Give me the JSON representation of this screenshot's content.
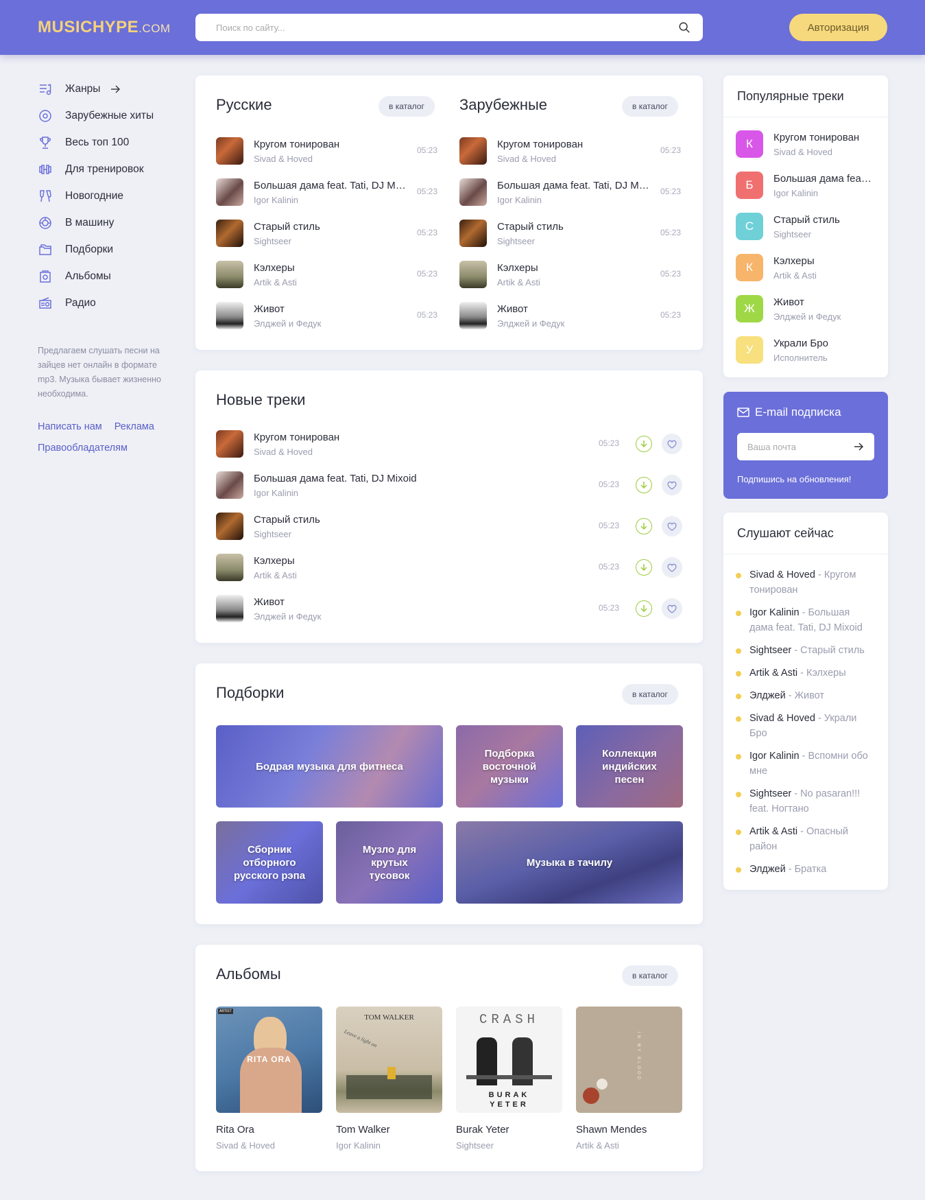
{
  "header": {
    "logo_main": "MUSICHYPE",
    "logo_domain": ".COM",
    "search_placeholder": "Поиск по сайту...",
    "auth_button": "Авторизация"
  },
  "sidebar": {
    "items": [
      {
        "label": "Жанры",
        "icon": "equalizer-icon"
      },
      {
        "label": "Зарубежные хиты",
        "icon": "disc-icon"
      },
      {
        "label": "Весь топ 100",
        "icon": "trophy-icon"
      },
      {
        "label": "Для тренировок",
        "icon": "dumbbell-icon"
      },
      {
        "label": "Новогодние",
        "icon": "glasses-icon"
      },
      {
        "label": "В машину",
        "icon": "wheel-icon"
      },
      {
        "label": "Подборки",
        "icon": "folders-icon"
      },
      {
        "label": "Альбомы",
        "icon": "album-icon"
      },
      {
        "label": "Радио",
        "icon": "radio-icon"
      }
    ],
    "about": "Предлагаем слушать песни на зайцев нет онлайн в формате mp3. Музыка бывает жизненно необходима.",
    "link_write": "Написать нам",
    "link_ads": "Реклама",
    "link_rights": "Правообладателям"
  },
  "tracks": [
    {
      "name": "Кругом тонирован",
      "artist": "Sivad & Hoved",
      "duration": "05:23"
    },
    {
      "name": "Большая дама feat. Tati, DJ Mixoid",
      "artist": "Igor Kalinin",
      "duration": "05:23"
    },
    {
      "name": "Старый стиль",
      "artist": "Sightseer",
      "duration": "05:23"
    },
    {
      "name": "Кэлхеры",
      "artist": "Artik & Asti",
      "duration": "05:23"
    },
    {
      "name": "Живот",
      "artist": "Элджей и Федук",
      "duration": "05:23"
    }
  ],
  "russian": {
    "title": "Русские",
    "catalog": "в каталог"
  },
  "foreign": {
    "title": "Зарубежные",
    "catalog": "в каталог"
  },
  "new_tracks": {
    "title": "Новые треки"
  },
  "collections": {
    "title": "Подборки",
    "catalog": "в каталог",
    "tiles": [
      "Бодрая музыка для фитнеса",
      "Подборка восточной музыки",
      "Коллекция индийских песен",
      "Сборник отборного русского рэпа",
      "Музло для крутых тусовок",
      "Музыка в тачилу"
    ]
  },
  "albums": {
    "title": "Альбомы",
    "catalog": "в каталог",
    "items": [
      {
        "name": "Rita Ora",
        "artist": "Sivad & Hoved",
        "cover_text": "RITA ORA",
        "badge": "ARTIST"
      },
      {
        "name": "Tom Walker",
        "artist": "Igor Kalinin",
        "cover_text": "TOM WALKER",
        "script": "Leave a light on"
      },
      {
        "name": "Burak Yeter",
        "artist": "Sightseer",
        "cover_text": "CRASH",
        "bottom_text": "BURAK YETER"
      },
      {
        "name": "Shawn Mendes",
        "artist": "Artik & Asti",
        "cover_text": "IN MY BLOOD"
      }
    ]
  },
  "popular": {
    "title": "Популярные треки",
    "items": [
      {
        "letter": "К",
        "name": "Кругом тонирован",
        "artist": "Sivad & Hoved",
        "color": "#d957e8"
      },
      {
        "letter": "Б",
        "name": "Большая дама feat. Tati",
        "artist": "Igor Kalinin",
        "color": "#f07070"
      },
      {
        "letter": "С",
        "name": "Старый стиль",
        "artist": "Sightseer",
        "color": "#6fd0d8"
      },
      {
        "letter": "К",
        "name": "Кэлхеры",
        "artist": "Artik & Asti",
        "color": "#f7b46b"
      },
      {
        "letter": "Ж",
        "name": "Живот",
        "artist": "Элджей и Федук",
        "color": "#9fd846"
      },
      {
        "letter": "У",
        "name": "Украли Бро",
        "artist": "Исполнитель",
        "color": "#f7e07d"
      }
    ]
  },
  "subscribe": {
    "title": "E-mail подписка",
    "placeholder": "Ваша почта",
    "note": "Подпишись на обновления!"
  },
  "listening": {
    "title": "Слушают сейчас",
    "items": [
      {
        "artist": "Sivad & Hoved",
        "track": "Кругом тонирован"
      },
      {
        "artist": "Igor Kalinin",
        "track": "Большая дама feat. Tati, DJ Mixoid"
      },
      {
        "artist": "Sightseer",
        "track": "Старый стиль"
      },
      {
        "artist": "Artik & Asti",
        "track": "Кэлхеры"
      },
      {
        "artist": "Элджей",
        "track": "Живот"
      },
      {
        "artist": "Sivad & Hoved",
        "track": "Украли Бро"
      },
      {
        "artist": "Igor Kalinin",
        "track": "Вспомни обо мне"
      },
      {
        "artist": "Sightseer",
        "track": "No pasaran!!! feat. Ногтано"
      },
      {
        "artist": "Artik & Asti",
        "track": "Опасный район"
      },
      {
        "artist": "Элджей",
        "track": "Братка"
      }
    ]
  }
}
